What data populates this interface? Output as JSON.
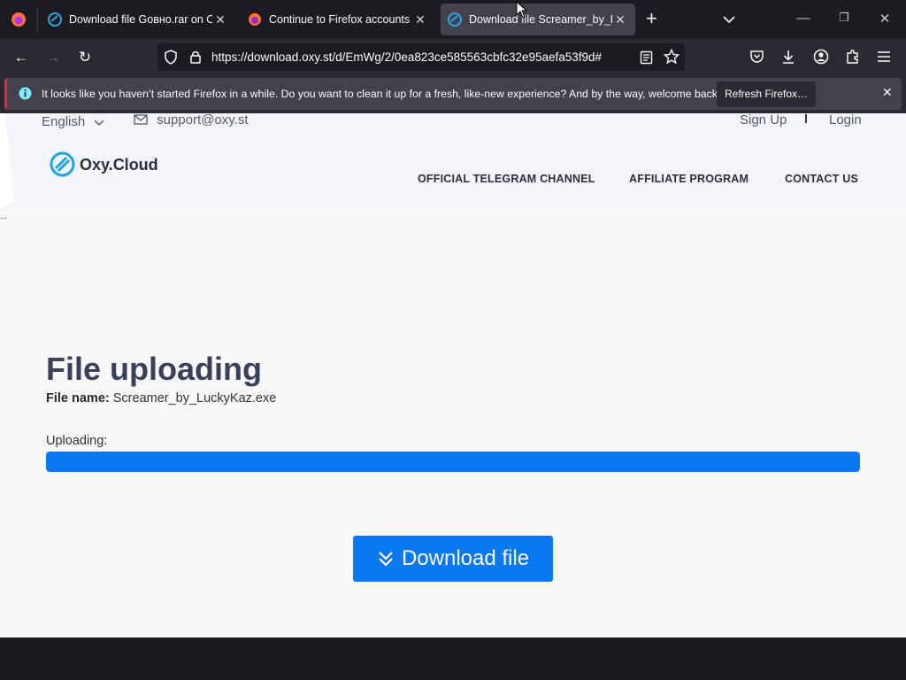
{
  "browser": {
    "tabs": [
      {
        "title": "Download file Gовно.rar on Ox"
      },
      {
        "title": "Continue to Firefox accounts"
      },
      {
        "title": "Download file Screamer_by_Lu"
      }
    ],
    "url": "https://download.oxy.st/d/EmWg/2/0ea823ce585563cbfc32e95aefa53f9d#",
    "notification": {
      "text": "It looks like you haven’t started Firefox in a while. Do you want to clean it up for a fresh, like-new experience? And by the way, welcome back!",
      "button": "Refresh Firefox…"
    }
  },
  "site": {
    "language": "English",
    "email": "support@oxy.st",
    "signup": "Sign Up",
    "login": "Login",
    "logo": "Oxy.Cloud",
    "nav": [
      "OFFICIAL TELEGRAM CHANNEL",
      "AFFILIATE PROGRAM",
      "CONTACT US"
    ],
    "side_mark": "..."
  },
  "main": {
    "title": "File uploading",
    "file_label": "File name:",
    "file_name": "Screamer_by_LuckyKaz.exe",
    "upload_label": "Uploading:",
    "progress": 1.0,
    "download_button": "Download file"
  },
  "colors": {
    "accent": "#0a78f0",
    "notif_stripe": "#e22850"
  }
}
